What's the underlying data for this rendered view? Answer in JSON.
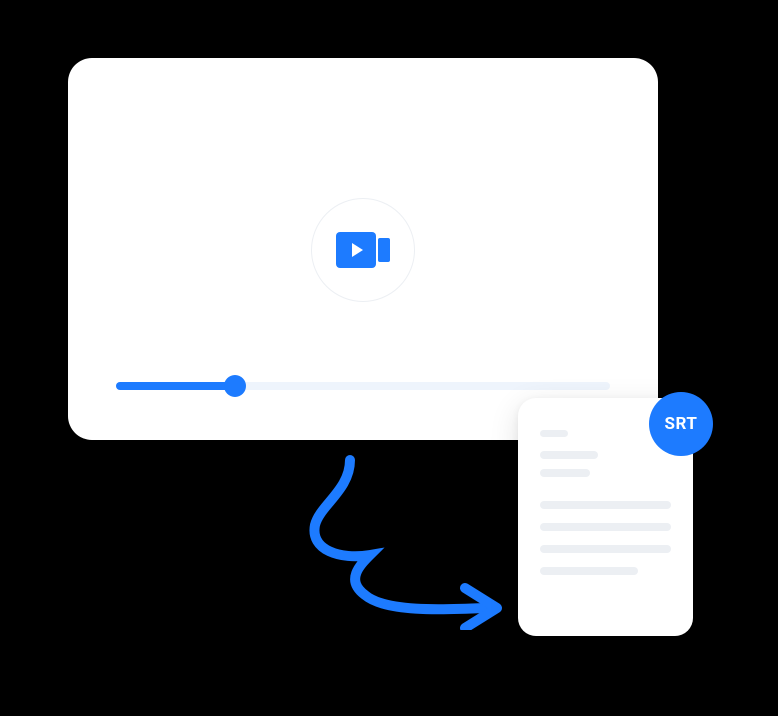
{
  "badge": {
    "label": "SRT"
  },
  "progress": {
    "percent": 24
  },
  "icons": {
    "video": "video-camera-icon",
    "arrow": "curved-arrow-icon",
    "document": "document-icon"
  }
}
